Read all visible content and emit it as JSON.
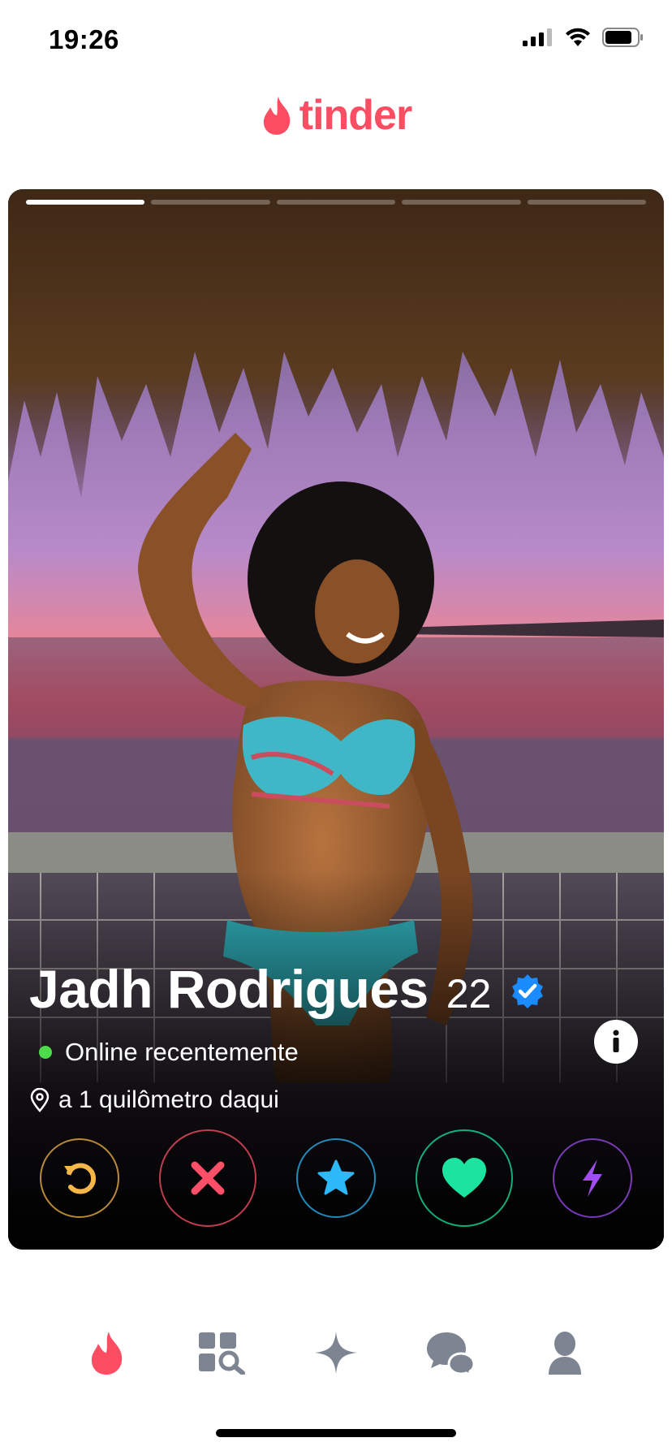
{
  "status_bar": {
    "time": "19:26"
  },
  "header": {
    "logo_text": "tinder",
    "brand_color": "#fd4d63"
  },
  "card": {
    "photo_count": 5,
    "active_photo": 1,
    "profile": {
      "name": "Jadh Rodrigues",
      "age": "22",
      "verified": true,
      "status": "Online recentemente",
      "distance": "a 1 quilômetro daqui"
    },
    "info_label": "i"
  },
  "actions": [
    {
      "name": "rewind",
      "color": "#f5b748"
    },
    {
      "name": "nope",
      "color": "#fd5068"
    },
    {
      "name": "super-like",
      "color": "#2db8f7"
    },
    {
      "name": "like",
      "color": "#1be4a1"
    },
    {
      "name": "boost",
      "color": "#a14cf4"
    }
  ],
  "bottom_nav": {
    "items": [
      "home",
      "explore",
      "gold",
      "messages",
      "profile"
    ],
    "active": "home",
    "active_color": "#fd4d63",
    "inactive_color": "#7c8591"
  }
}
